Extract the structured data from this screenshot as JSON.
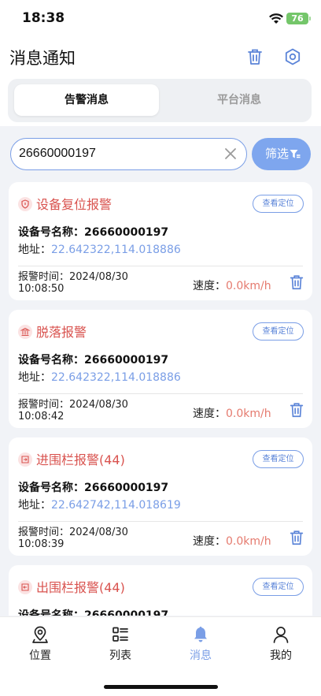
{
  "status": {
    "time": "18:38",
    "battery": "76"
  },
  "header": {
    "title": "消息通知",
    "delete_icon": "trash-icon",
    "settings_icon": "gear-icon"
  },
  "tabs": [
    {
      "label": "告警消息",
      "active": true
    },
    {
      "label": "平台消息",
      "active": false
    }
  ],
  "search": {
    "value": "26660000197",
    "placeholder": ""
  },
  "filter": {
    "label": "筛选"
  },
  "cards": [
    {
      "title": "设备复位报警",
      "icon": "shield-icon",
      "locate_label": "查看定位",
      "device_label": "设备号名称：",
      "device": "26660000197",
      "addr_label": "地址：",
      "addr": "22.642322,114.018886",
      "time_label": "报警时间：",
      "date": "2024/08/30",
      "time": "10:08:50",
      "speed_label": "速度：",
      "speed": "0.0km/h"
    },
    {
      "title": "脱落报警",
      "icon": "building-icon",
      "locate_label": "查看定位",
      "device_label": "设备号名称：",
      "device": "26660000197",
      "addr_label": "地址：",
      "addr": "22.642322,114.018886",
      "time_label": "报警时间：",
      "date": "2024/08/30",
      "time": "10:08:42",
      "speed_label": "速度：",
      "speed": "0.0km/h"
    },
    {
      "title": "进围栏报警(44)",
      "icon": "fence-in-icon",
      "locate_label": "查看定位",
      "device_label": "设备号名称：",
      "device": "26660000197",
      "addr_label": "地址：",
      "addr": "22.642742,114.018619",
      "time_label": "报警时间：",
      "date": "2024/08/30",
      "time": "10:08:39",
      "speed_label": "速度：",
      "speed": "0.0km/h"
    },
    {
      "title": "出围栏报警(44)",
      "icon": "fence-out-icon",
      "locate_label": "查看定位",
      "device_label": "设备号名称：",
      "device": "26660000197"
    }
  ],
  "tabbar": [
    {
      "label": "位置",
      "icon": "location-icon",
      "active": false
    },
    {
      "label": "列表",
      "icon": "list-icon",
      "active": false
    },
    {
      "label": "消息",
      "icon": "bell-icon",
      "active": true
    },
    {
      "label": "我的",
      "icon": "user-icon",
      "active": false
    }
  ],
  "colors": {
    "accent": "#7a9ee6",
    "alert": "#d9534f",
    "speed": "#e57a6e",
    "battery": "#74c66a"
  }
}
